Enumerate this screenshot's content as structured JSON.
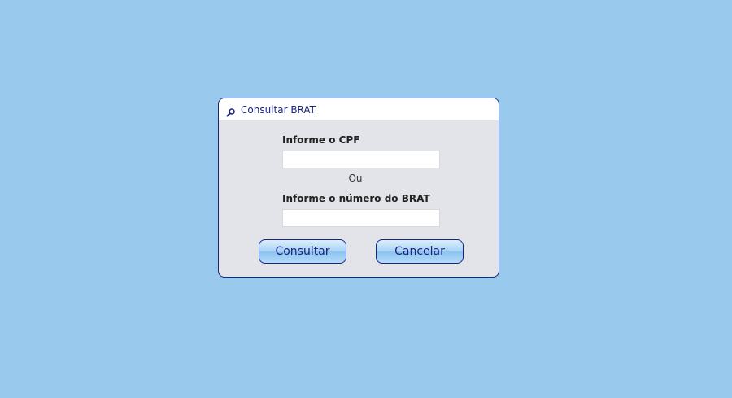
{
  "dialog": {
    "title": "Consultar BRAT",
    "title_icon": "magnifier-icon",
    "cpf_label": "Informe o CPF",
    "cpf_value": "",
    "or_label": "Ou",
    "brat_label": "Informe o número do BRAT",
    "brat_value": "",
    "consultar_label": "Consultar",
    "cancelar_label": "Cancelar"
  },
  "colors": {
    "page_background": "#99caee",
    "dialog_background": "#e3e4ea",
    "dialog_border": "#1a237e",
    "title_text": "#1a237e",
    "button_text": "#1a237e"
  }
}
